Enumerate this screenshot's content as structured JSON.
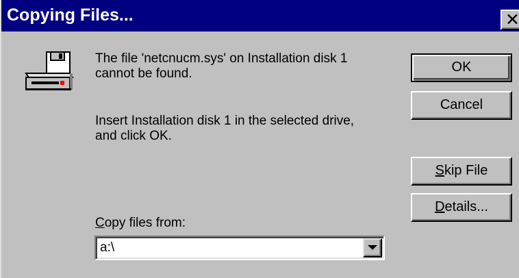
{
  "window": {
    "title": "Copying Files...",
    "close_glyph": "✕"
  },
  "message": {
    "line1": "The file 'netcnucm.sys' on Installation disk 1\ncannot be found.",
    "line2": "Insert Installation disk 1 in the selected drive,\nand click OK."
  },
  "buttons": {
    "ok": "OK",
    "cancel": "Cancel",
    "skip_file": "Skip File",
    "details": "Details..."
  },
  "copy_from": {
    "label": "Copy files from:",
    "value": "a:\\"
  },
  "icons": {
    "disk": "floppy-drive-icon",
    "dropdown": "dropdown-arrow-icon",
    "close": "close-icon"
  },
  "colors": {
    "titlebar": "#000080",
    "face": "#c0c0c0"
  }
}
